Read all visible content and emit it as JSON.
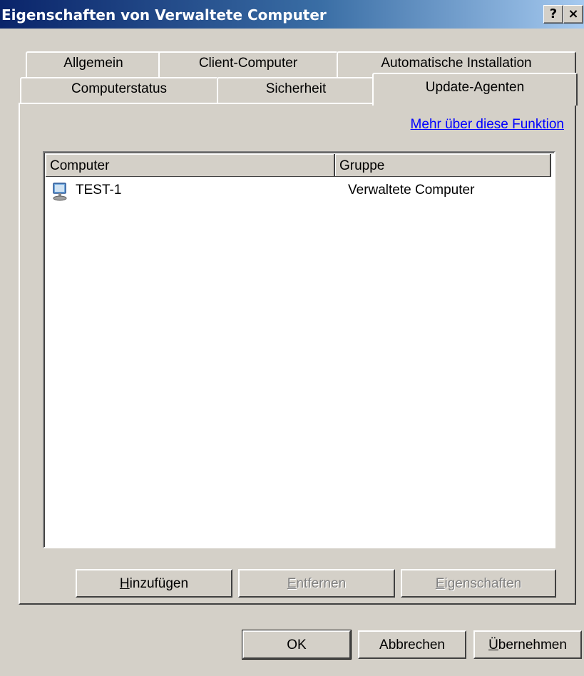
{
  "window": {
    "title": "Eigenschaften von Verwaltete Computer",
    "help_label": "?",
    "close_label": "×"
  },
  "tabs_row1": [
    {
      "label": "Allgemein"
    },
    {
      "label": "Client-Computer"
    },
    {
      "label": "Automatische Installation"
    }
  ],
  "tabs_row2": [
    {
      "label": "Computerstatus"
    },
    {
      "label": "Sicherheit"
    },
    {
      "label": "Update-Agenten",
      "active": true
    }
  ],
  "panel": {
    "more_link": "Mehr über diese Funktion",
    "list": {
      "columns": [
        "Computer",
        "Gruppe"
      ],
      "rows": [
        {
          "icon": "computer-icon",
          "computer": "TEST-1",
          "group": "Verwaltete Computer"
        }
      ]
    },
    "buttons": {
      "add": {
        "mnemonic": "H",
        "rest": "inzufügen"
      },
      "remove": {
        "mnemonic": "E",
        "rest": "ntfernen"
      },
      "properties": {
        "mnemonic": "E",
        "rest": "igenschaften"
      }
    }
  },
  "footer": {
    "ok": "OK",
    "cancel": "Abbrechen",
    "apply": {
      "mnemonic": "Ü",
      "rest": "bernehmen"
    }
  }
}
